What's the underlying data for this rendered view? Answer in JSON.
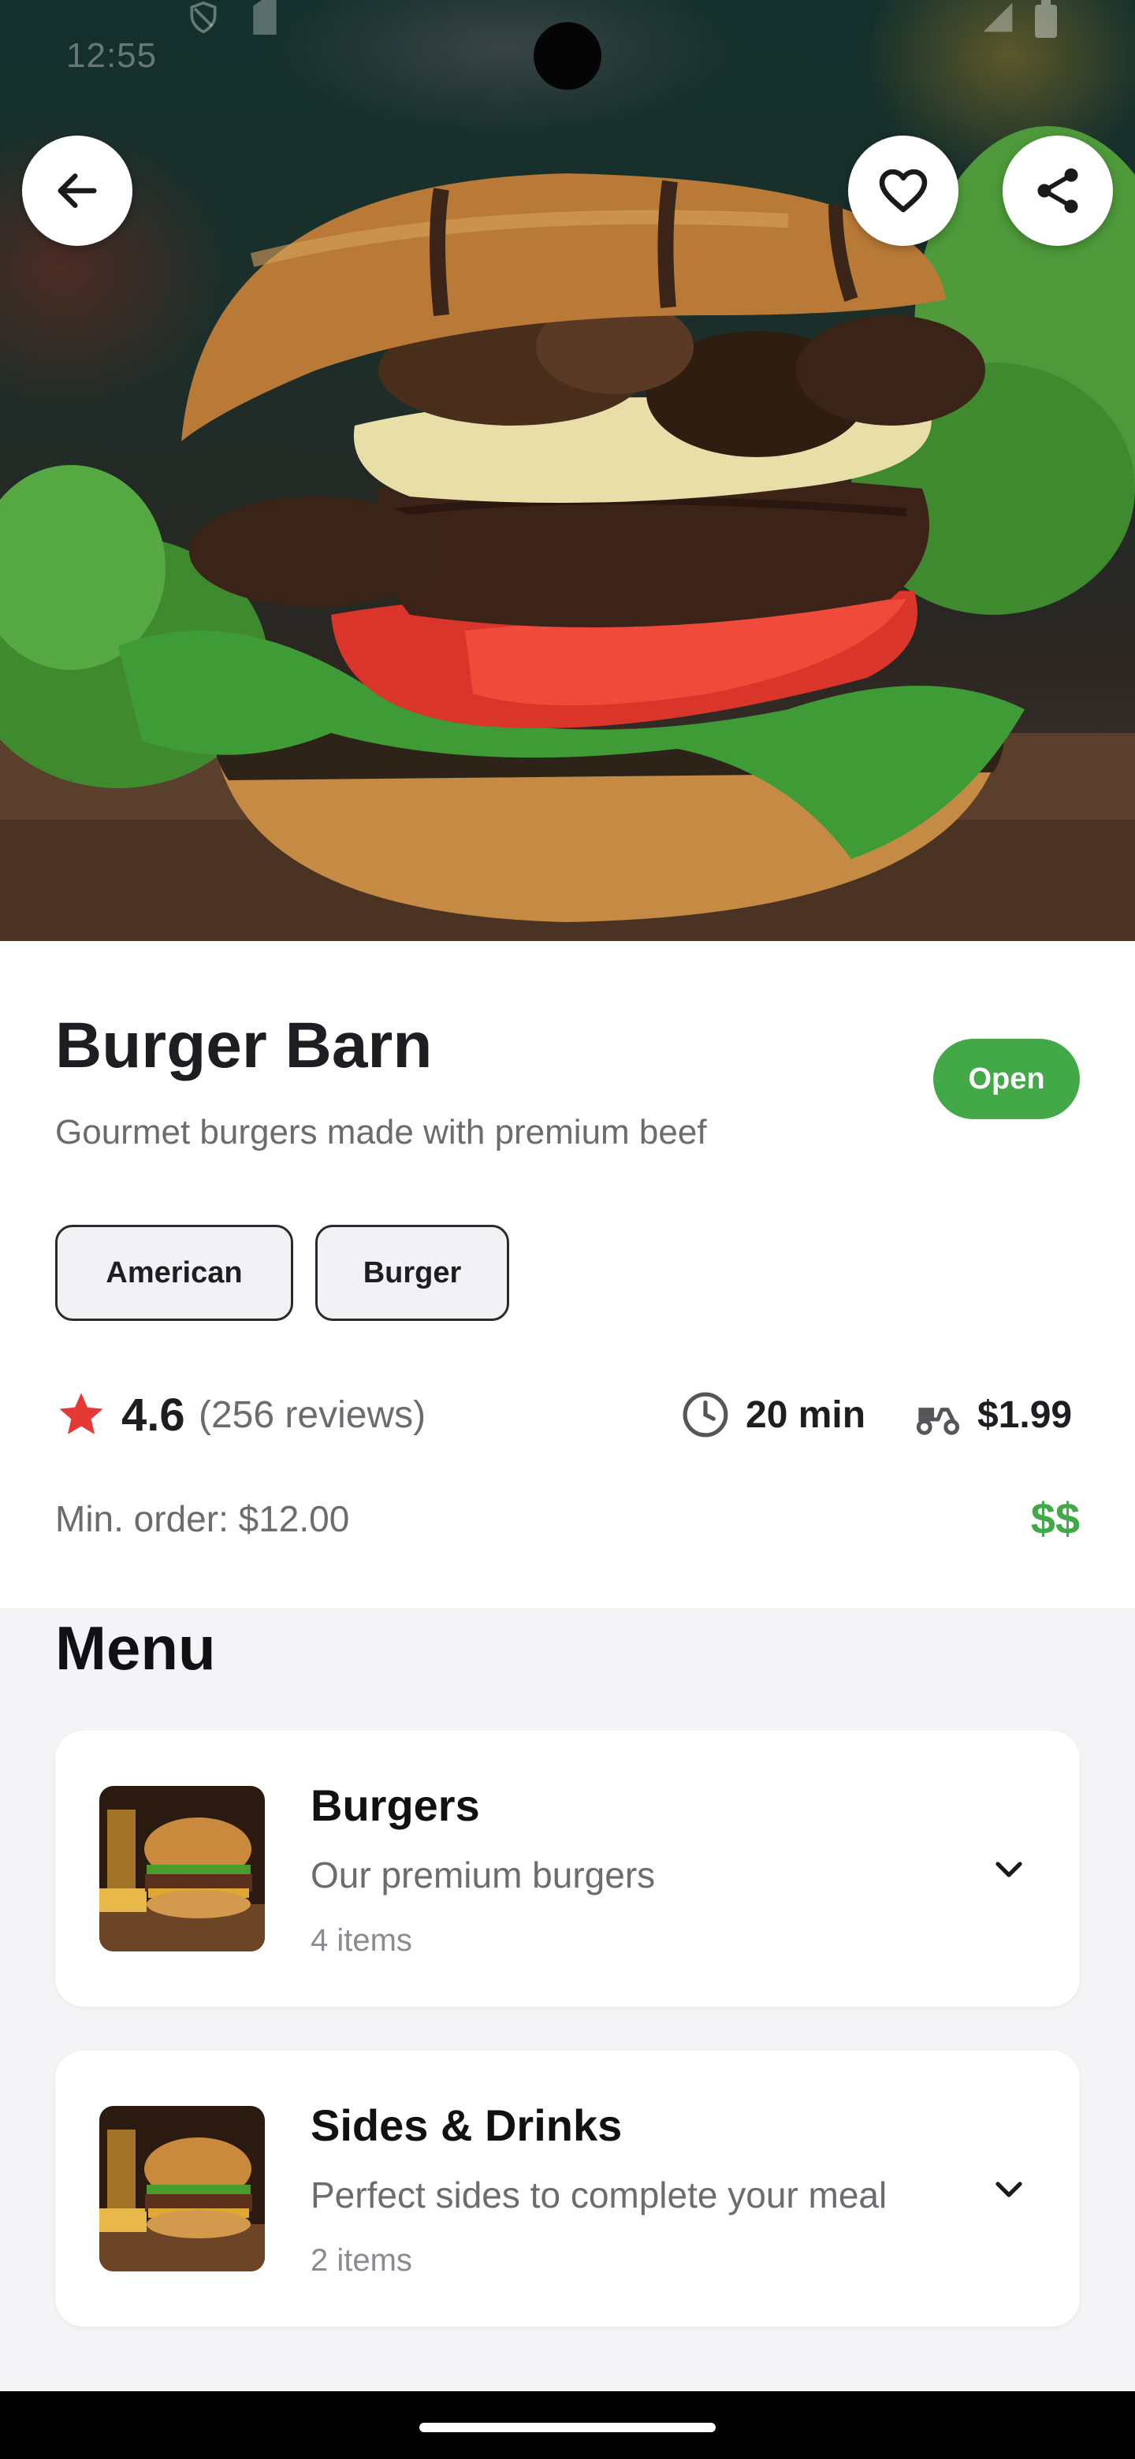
{
  "status_bar": {
    "time": "12:55"
  },
  "hero": {
    "image_subject": "gourmet burger with mushrooms, cheese, tomato and lettuce",
    "back_icon": "arrow-left-icon",
    "favorite_icon": "heart-outline-icon",
    "share_icon": "share-icon"
  },
  "restaurant": {
    "name": "Burger Barn",
    "description": "Gourmet burgers made with premium beef",
    "status": "Open",
    "tags": [
      "American",
      "Burger"
    ],
    "rating": "4.6",
    "reviews": "(256 reviews)",
    "delivery_time": "20 min",
    "delivery_fee": "$1.99",
    "min_order": "Min. order: $12.00",
    "price_level": "$$"
  },
  "menu": {
    "title": "Menu",
    "categories": [
      {
        "name": "Burgers",
        "description": "Our premium burgers",
        "count": "4 items"
      },
      {
        "name": "Sides & Drinks",
        "description": "Perfect sides to complete your meal",
        "count": "2 items"
      }
    ]
  },
  "colors": {
    "accent_green": "#43a848",
    "star_red": "#e53935",
    "text_dark": "#1e1e22",
    "text_muted": "#6b6b70"
  }
}
